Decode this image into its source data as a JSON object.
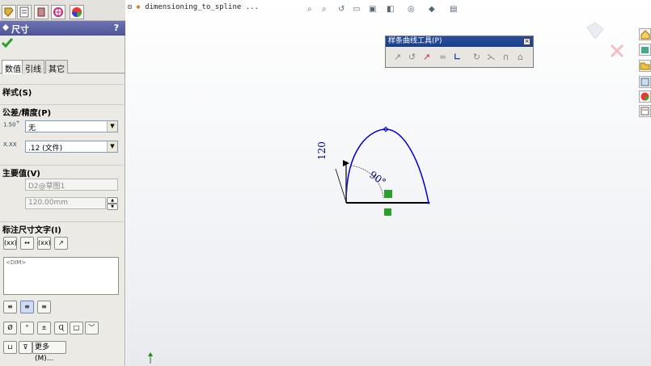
{
  "panel": {
    "title": "尺寸",
    "help": "?",
    "tabs": [
      "数值",
      "引线",
      "其它"
    ],
    "style_group": {
      "label": "样式(S)"
    },
    "tolerance_group": {
      "label": "公差/精度(P)",
      "tolerance_value": "无",
      "precision_value": ".12 (文件)"
    },
    "primary_group": {
      "label": "主要值(V)",
      "name_field": "D2@草图1",
      "value_field": "120.00mm"
    },
    "dimtext_group": {
      "label": "标注尺寸文字(I)",
      "text": "<DIM>",
      "more_button": "更多(M)..."
    }
  },
  "gfx": {
    "document": "dimensioning_to_spline ...",
    "spline_toolbar_title": "样条曲线工具(P)",
    "spline_toolbar_close": "×",
    "dim_vertical": "120",
    "dim_angle": "90°"
  },
  "colors": {
    "panel_header": "#5a60a0",
    "spline": "#0000d0",
    "dimension_text": "#000080"
  },
  "icons": [
    "feature-manager-icon",
    "property-manager-icon",
    "configuration-manager-icon",
    "dimxpert-icon",
    "display-manager-icon",
    "checkmark-icon",
    "home-icon",
    "library-icon",
    "folder-icon",
    "view-palette-icon",
    "appearance-icon",
    "custom-properties-icon"
  ]
}
